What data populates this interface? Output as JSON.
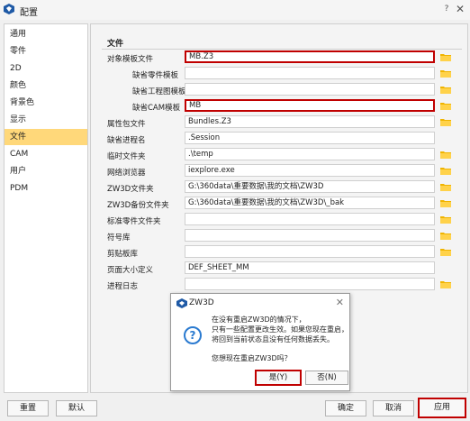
{
  "window": {
    "title": "配置"
  },
  "sidebar": {
    "items": [
      {
        "label": "通用"
      },
      {
        "label": "零件"
      },
      {
        "label": "2D"
      },
      {
        "label": "颜色"
      },
      {
        "label": "背景色"
      },
      {
        "label": "显示"
      },
      {
        "label": "文件",
        "active": true
      },
      {
        "label": "CAM"
      },
      {
        "label": "用户"
      },
      {
        "label": "PDM"
      }
    ]
  },
  "section": {
    "title": "文件"
  },
  "rows": [
    {
      "label": "对象模板文件",
      "value": "MB.Z3",
      "highlight": true
    },
    {
      "label": "缺省零件模板",
      "value": ""
    },
    {
      "label": "缺省工程图模板",
      "value": ""
    },
    {
      "label": "缺省CAM模板",
      "value": "MB",
      "highlight": true
    },
    {
      "label": "属性包文件",
      "value": "Bundles.Z3"
    },
    {
      "label": "缺省进程名",
      "value": ".Session"
    },
    {
      "label": "临时文件夹",
      "value": ".\\temp"
    },
    {
      "label": "网络浏览器",
      "value": "iexplore.exe"
    },
    {
      "label": "ZW3D文件夹",
      "value": "G:\\360data\\重要数据\\我的文档\\ZW3D"
    },
    {
      "label": "ZW3D备份文件夹",
      "value": "G:\\360data\\重要数据\\我的文档\\ZW3D\\_bak"
    },
    {
      "label": "标准零件文件夹",
      "value": ""
    },
    {
      "label": "符号库",
      "value": ""
    },
    {
      "label": "剪贴板库",
      "value": ""
    },
    {
      "label": "页面大小定义",
      "value": "DEF_SHEET_MM"
    },
    {
      "label": "进程日志",
      "value": ""
    }
  ],
  "buttons": {
    "reset": "重置",
    "default": "默认",
    "ok": "确定",
    "cancel": "取消",
    "apply": "应用"
  },
  "dialog": {
    "title": "ZW3D",
    "lines": [
      "在没有重启ZW3D的情况下，",
      "只有一些配置更改生效。如果您现在重启，",
      "将回到当前状态且没有任何数据丢失。"
    ],
    "question": "您想现在重启ZW3D吗？",
    "yes": "是(Y)",
    "no": "否(N)"
  },
  "colors": {
    "accent": "#ffd87a",
    "highlight": "#c00000",
    "folder": "#f0b400"
  }
}
